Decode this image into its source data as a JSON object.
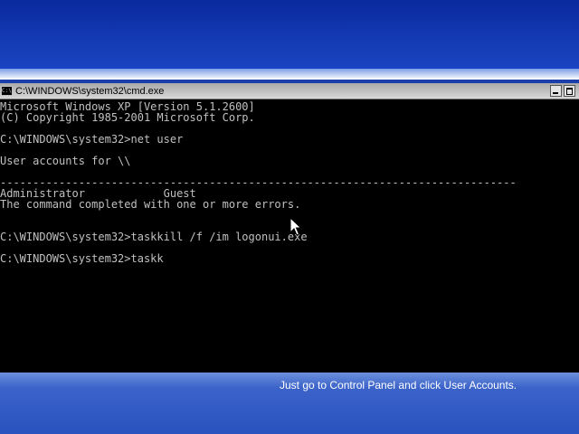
{
  "window": {
    "title": "C:\\WINDOWS\\system32\\cmd.exe"
  },
  "console": {
    "lines": [
      "Microsoft Windows XP [Version 5.1.2600]",
      "(C) Copyright 1985-2001 Microsoft Corp.",
      "",
      "C:\\WINDOWS\\system32>net user",
      "",
      "User accounts for \\\\",
      "",
      "-------------------------------------------------------------------------------",
      "Administrator            Guest",
      "The command completed with one or more errors.",
      "",
      "",
      "C:\\WINDOWS\\system32>taskkill /f /im logonui.exe",
      "",
      "C:\\WINDOWS\\system32>taskk"
    ]
  },
  "desktop": {
    "hint": "Just go to Control Panel and click User Accounts."
  },
  "colors": {
    "console_background": "#000000",
    "console_text": "#c0c0c0",
    "desktop_blue": "#1a3fa8"
  },
  "icons": {
    "window_icon": "cmd-icon",
    "minimize": "minimize-icon",
    "maximize": "maximize-icon",
    "pointer": "mouse-cursor-icon"
  }
}
